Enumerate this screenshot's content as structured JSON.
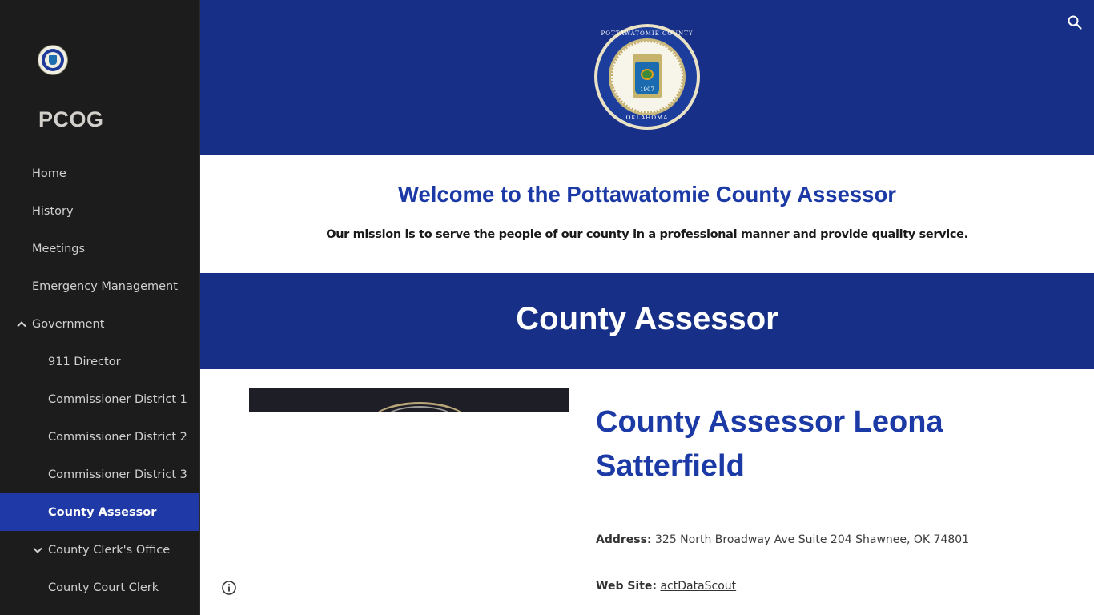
{
  "sidebar": {
    "site_title": "PCOG",
    "items": [
      {
        "label": "Home",
        "level": 1,
        "chevron": null,
        "active": false
      },
      {
        "label": "History",
        "level": 1,
        "chevron": null,
        "active": false
      },
      {
        "label": "Meetings",
        "level": 1,
        "chevron": null,
        "active": false
      },
      {
        "label": "Emergency Management",
        "level": 1,
        "chevron": null,
        "active": false
      },
      {
        "label": "Government",
        "level": 1,
        "chevron": "chevron-up",
        "active": false
      },
      {
        "label": "911 Director",
        "level": 2,
        "chevron": null,
        "active": false
      },
      {
        "label": "Commissioner District 1",
        "level": 2,
        "chevron": null,
        "active": false
      },
      {
        "label": "Commissioner District 2",
        "level": 2,
        "chevron": null,
        "active": false
      },
      {
        "label": "Commissioner District 3",
        "level": 2,
        "chevron": null,
        "active": false
      },
      {
        "label": "County Assessor",
        "level": 2,
        "chevron": null,
        "active": true
      },
      {
        "label": "County Clerk's Office",
        "level": 2,
        "chevron": "chevron-down",
        "active": false
      },
      {
        "label": "County Court Clerk",
        "level": 2,
        "chevron": null,
        "active": false
      }
    ]
  },
  "header": {
    "search_icon": "search-icon",
    "seal": {
      "top_text": "POTTAWATOMIE COUNTY",
      "bottom_text": "OKLAHOMA",
      "year": "1907"
    }
  },
  "welcome": {
    "heading": "Welcome to the Pottawatomie County Assessor",
    "mission": "Our mission is to serve the people of our county in a professional manner and provide quality service."
  },
  "section": {
    "title": "County Assessor"
  },
  "content": {
    "person_title": "County Assessor Leona Satterfield",
    "address_label": "Address:",
    "address_value": "325 North Broadway Ave Suite 204 Shawnee, OK 74801",
    "website_label": "Web Site:",
    "website_link": "actDataScout"
  },
  "footer": {
    "info_icon": "info-icon"
  },
  "colors": {
    "brand_blue": "#172f86",
    "accent_blue": "#1c3aa6",
    "sidebar_bg": "#1c1c1c",
    "active_item_bg": "#1f3aa6"
  }
}
